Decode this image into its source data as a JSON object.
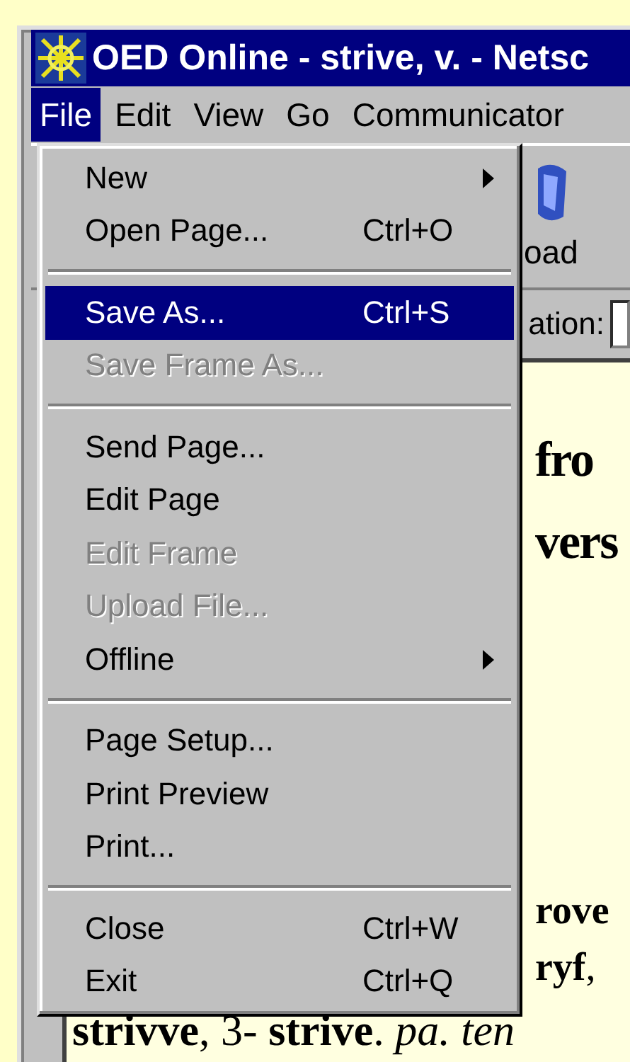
{
  "window": {
    "title": "OED Online - strive, v. - Netsc"
  },
  "menubar": [
    {
      "label": "File",
      "selected": true
    },
    {
      "label": "Edit",
      "selected": false
    },
    {
      "label": "View",
      "selected": false
    },
    {
      "label": "Go",
      "selected": false
    },
    {
      "label": "Communicator",
      "selected": false
    }
  ],
  "toolbar": {
    "button_label": "oad"
  },
  "location": {
    "label": "ation:"
  },
  "content": {
    "heading_lines": [
      "fro",
      "vers"
    ],
    "body_lines": [
      {
        "kind": "bold",
        "text": "rove"
      },
      {
        "kind": "rich",
        "text": "**ryf**,"
      },
      {
        "kind": "rich",
        "text": "**strivve**, 3- **strive**. *pa. ten*"
      }
    ]
  },
  "file_menu": [
    {
      "kind": "item",
      "label": "New",
      "submenu": true,
      "disabled": false,
      "selected": false
    },
    {
      "kind": "item",
      "label": "Open Page...",
      "shortcut": "Ctrl+O",
      "submenu": false,
      "disabled": false,
      "selected": false
    },
    {
      "kind": "separator"
    },
    {
      "kind": "item",
      "label": "Save As...",
      "shortcut": "Ctrl+S",
      "submenu": false,
      "disabled": false,
      "selected": true
    },
    {
      "kind": "item",
      "label": "Save Frame As...",
      "submenu": false,
      "disabled": true,
      "selected": false
    },
    {
      "kind": "separator"
    },
    {
      "kind": "item",
      "label": "Send Page...",
      "submenu": false,
      "disabled": false,
      "selected": false
    },
    {
      "kind": "item",
      "label": "Edit Page",
      "submenu": false,
      "disabled": false,
      "selected": false
    },
    {
      "kind": "item",
      "label": "Edit Frame",
      "submenu": false,
      "disabled": true,
      "selected": false
    },
    {
      "kind": "item",
      "label": "Upload File...",
      "submenu": false,
      "disabled": true,
      "selected": false
    },
    {
      "kind": "item",
      "label": "Offline",
      "submenu": true,
      "disabled": false,
      "selected": false
    },
    {
      "kind": "separator"
    },
    {
      "kind": "item",
      "label": "Page Setup...",
      "submenu": false,
      "disabled": false,
      "selected": false
    },
    {
      "kind": "item",
      "label": "Print Preview",
      "submenu": false,
      "disabled": false,
      "selected": false
    },
    {
      "kind": "item",
      "label": "Print...",
      "submenu": false,
      "disabled": false,
      "selected": false
    },
    {
      "kind": "separator"
    },
    {
      "kind": "item",
      "label": "Close",
      "shortcut": "Ctrl+W",
      "submenu": false,
      "disabled": false,
      "selected": false
    },
    {
      "kind": "item",
      "label": "Exit",
      "shortcut": "Ctrl+Q",
      "submenu": false,
      "disabled": false,
      "selected": false
    }
  ]
}
